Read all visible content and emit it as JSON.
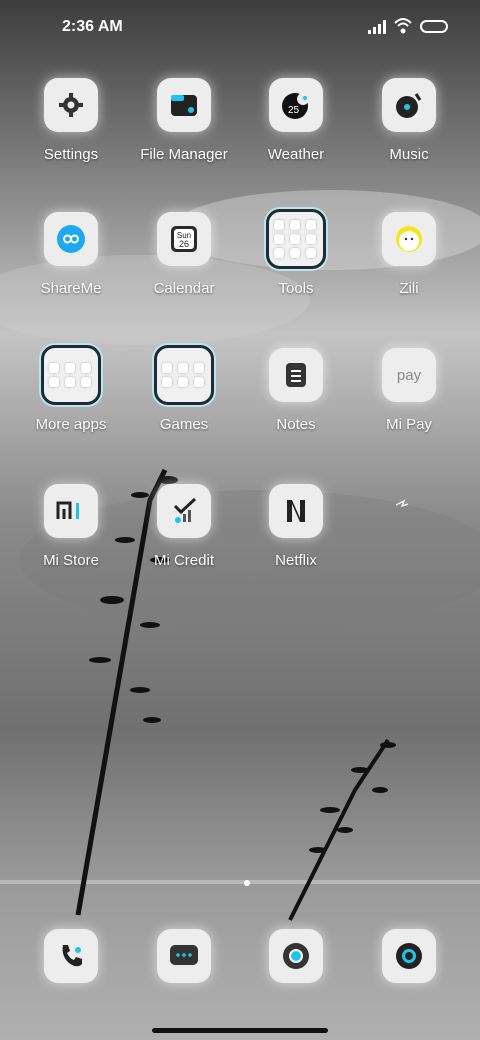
{
  "status": {
    "time": "2:36 AM"
  },
  "apps": [
    {
      "label": "Settings"
    },
    {
      "label": "File Manager"
    },
    {
      "label": "Weather",
      "badge": "25"
    },
    {
      "label": "Music"
    },
    {
      "label": "ShareMe"
    },
    {
      "label": "Calendar",
      "day": "Sun",
      "date": "26"
    },
    {
      "label": "Tools"
    },
    {
      "label": "Zili"
    },
    {
      "label": "More apps"
    },
    {
      "label": "Games"
    },
    {
      "label": "Notes"
    },
    {
      "label": "Mi Pay",
      "glyph": "pay"
    },
    {
      "label": "Mi Store"
    },
    {
      "label": "Mi Credit"
    },
    {
      "label": "Netflix"
    }
  ],
  "dock": [
    "phone-icon",
    "messages-icon",
    "chrome-icon",
    "camera-icon"
  ]
}
